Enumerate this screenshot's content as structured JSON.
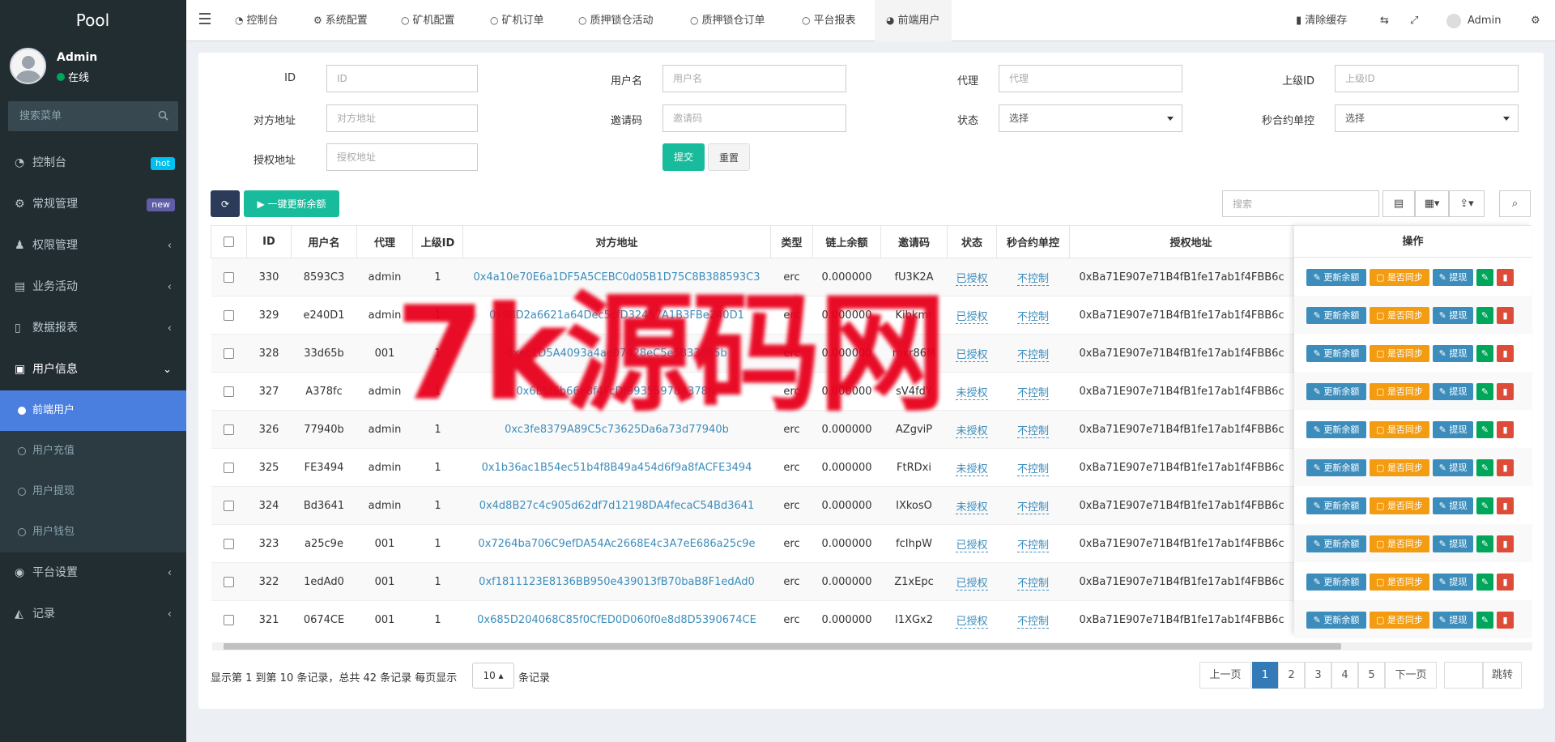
{
  "app": {
    "brand": "Pool"
  },
  "user": {
    "name": "Admin",
    "status": "在线"
  },
  "sidebar": {
    "search_placeholder": "搜索菜单",
    "items": [
      {
        "label": "控制台",
        "badge": "hot",
        "badge_color": "#00c0ef"
      },
      {
        "label": "常规管理",
        "badge": "new",
        "badge_color": "#605ca8"
      },
      {
        "label": "权限管理"
      },
      {
        "label": "业务活动"
      },
      {
        "label": "数据报表"
      },
      {
        "label": "用户信息"
      }
    ],
    "sub_items": [
      {
        "label": "前端用户"
      },
      {
        "label": "用户充值"
      },
      {
        "label": "用户提现"
      },
      {
        "label": "用户钱包"
      }
    ],
    "bottom_items": [
      {
        "label": "平台设置"
      },
      {
        "label": "记录"
      }
    ]
  },
  "tabs": [
    {
      "label": "控制台"
    },
    {
      "label": "系统配置"
    },
    {
      "label": "矿机配置"
    },
    {
      "label": "矿机订单"
    },
    {
      "label": "质押锁仓活动"
    },
    {
      "label": "质押锁仓订单"
    },
    {
      "label": "平台报表"
    },
    {
      "label": "前端用户"
    }
  ],
  "topright": {
    "clear_cache": "清除缓存",
    "admin": "Admin"
  },
  "filters": {
    "id": {
      "label": "ID",
      "placeholder": "ID"
    },
    "username": {
      "label": "用户名",
      "placeholder": "用户名"
    },
    "agent": {
      "label": "代理",
      "placeholder": "代理"
    },
    "parent_id": {
      "label": "上级ID",
      "placeholder": "上级ID"
    },
    "opp_addr": {
      "label": "对方地址",
      "placeholder": "对方地址"
    },
    "invite": {
      "label": "邀请码",
      "placeholder": "邀请码"
    },
    "status": {
      "label": "状态",
      "value": "选择"
    },
    "sec_ctrl": {
      "label": "秒合约单控",
      "value": "选择"
    },
    "auth_addr": {
      "label": "授权地址",
      "placeholder": "授权地址"
    },
    "submit": "提交",
    "reset": "重置"
  },
  "toolbar": {
    "refresh_balance": "▶ 一键更新余额",
    "search_placeholder": "搜索"
  },
  "table": {
    "headers": [
      "ID",
      "用户名",
      "代理",
      "上级ID",
      "对方地址",
      "类型",
      "链上余额",
      "邀请码",
      "状态",
      "秒合约单控",
      "授权地址"
    ],
    "ops_header": "操作",
    "op_labels": {
      "update": "更新余额",
      "sync": "是否同步",
      "withdraw": "提现"
    },
    "rows": [
      {
        "id": "330",
        "user": "8593C3",
        "agent": "admin",
        "pid": "1",
        "addr": "0x4a10e70E6a1DF5A5CEBC0d05B1D75C8B388593C3",
        "type": "erc",
        "bal": "0.000000",
        "code": "fU3K2A",
        "status": "已授权",
        "ctrl": "不控制",
        "auth": "0xBa71E907e71B4fB1fe17ab1f4FBB6c"
      },
      {
        "id": "329",
        "user": "e240D1",
        "agent": "admin",
        "pid": "1",
        "addr": "0x98D2a6621a64Dec5cfD32457A1B3FBe240D1",
        "type": "erc",
        "bal": "0.000000",
        "code": "Kibkmr",
        "status": "已授权",
        "ctrl": "不控制",
        "auth": "0xBa71E907e71B4fB1fe17ab1f4FBB6c"
      },
      {
        "id": "328",
        "user": "33d65b",
        "agent": "001",
        "pid": "1",
        "addr": "0xec1D5A4093a4ae07428eC5e5833d65b",
        "type": "erc",
        "bal": "0.000000",
        "code": "mxr86M",
        "status": "已授权",
        "ctrl": "不控制",
        "auth": "0xBa71E907e71B4fB1fe17ab1f4FBB6c"
      },
      {
        "id": "327",
        "user": "A378fc",
        "agent": "admin",
        "pid": "1",
        "addr": "0x6E5f6b66e8f4FcDf99355978A378fc",
        "type": "erc",
        "bal": "0.000000",
        "code": "sV4fdY",
        "status": "未授权",
        "ctrl": "不控制",
        "auth": "0xBa71E907e71B4fB1fe17ab1f4FBB6c"
      },
      {
        "id": "326",
        "user": "77940b",
        "agent": "admin",
        "pid": "1",
        "addr": "0xc3fe8379A89C5c73625Da6a73d77940b",
        "type": "erc",
        "bal": "0.000000",
        "code": "AZgviP",
        "status": "未授权",
        "ctrl": "不控制",
        "auth": "0xBa71E907e71B4fB1fe17ab1f4FBB6c"
      },
      {
        "id": "325",
        "user": "FE3494",
        "agent": "admin",
        "pid": "1",
        "addr": "0x1b36ac1B54ec51b4f8B49a454d6f9a8fACFE3494",
        "type": "erc",
        "bal": "0.000000",
        "code": "FtRDxi",
        "status": "未授权",
        "ctrl": "不控制",
        "auth": "0xBa71E907e71B4fB1fe17ab1f4FBB6c"
      },
      {
        "id": "324",
        "user": "Bd3641",
        "agent": "admin",
        "pid": "1",
        "addr": "0x4d8B27c4c905d62df7d12198DA4fecaC54Bd3641",
        "type": "erc",
        "bal": "0.000000",
        "code": "IXkosO",
        "status": "未授权",
        "ctrl": "不控制",
        "auth": "0xBa71E907e71B4fB1fe17ab1f4FBB6c"
      },
      {
        "id": "323",
        "user": "a25c9e",
        "agent": "001",
        "pid": "1",
        "addr": "0x7264ba706C9efDA54Ac2668E4c3A7eE686a25c9e",
        "type": "erc",
        "bal": "0.000000",
        "code": "fcIhpW",
        "status": "已授权",
        "ctrl": "不控制",
        "auth": "0xBa71E907e71B4fB1fe17ab1f4FBB6c"
      },
      {
        "id": "322",
        "user": "1edAd0",
        "agent": "001",
        "pid": "1",
        "addr": "0xf1811123E8136BB950e439013fB70baB8F1edAd0",
        "type": "erc",
        "bal": "0.000000",
        "code": "Z1xEpc",
        "status": "已授权",
        "ctrl": "不控制",
        "auth": "0xBa71E907e71B4fB1fe17ab1f4FBB6c"
      },
      {
        "id": "321",
        "user": "0674CE",
        "agent": "001",
        "pid": "1",
        "addr": "0x685D204068C85f0CfED0D060f0e8d8D5390674CE",
        "type": "erc",
        "bal": "0.000000",
        "code": "I1XGx2",
        "status": "已授权",
        "ctrl": "不控制",
        "auth": "0xBa71E907e71B4fB1fe17ab1f4FBB6c"
      }
    ]
  },
  "footer": {
    "info": "显示第 1 到第 10 条记录，总共 42 条记录 每页显示",
    "page_size": "10 ▴",
    "suffix": "条记录",
    "prev": "上一页",
    "next": "下一页",
    "pages": [
      "1",
      "2",
      "3",
      "4",
      "5"
    ],
    "jump": "跳转"
  },
  "watermark": "7k源码网",
  "colors": {
    "update": "#3c8dbc",
    "sync": "#f39c12",
    "withdraw": "#3c8dbc",
    "edit": "#00a65a",
    "del": "#dd4b39",
    "submit": "#18bc9c"
  }
}
